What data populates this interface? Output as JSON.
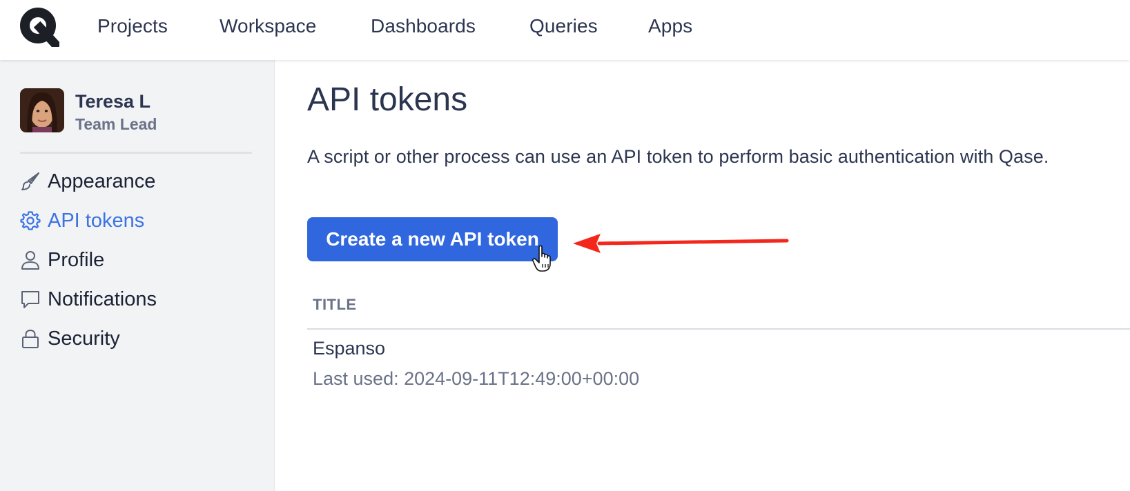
{
  "nav": {
    "logo_icon": "qase-q-logo",
    "items": [
      {
        "label": "Projects"
      },
      {
        "label": "Workspace"
      },
      {
        "label": "Dashboards"
      },
      {
        "label": "Queries"
      },
      {
        "label": "Apps"
      }
    ]
  },
  "sidebar": {
    "user": {
      "name": "Teresa L",
      "role": "Team Lead"
    },
    "items": [
      {
        "label": "Appearance",
        "icon": "brush-icon"
      },
      {
        "label": "API tokens",
        "icon": "gear-icon",
        "active": true
      },
      {
        "label": "Profile",
        "icon": "user-icon"
      },
      {
        "label": "Notifications",
        "icon": "chat-bubble-icon"
      },
      {
        "label": "Security",
        "icon": "lock-icon"
      }
    ]
  },
  "main": {
    "title": "API tokens",
    "description": "A script or other process can use an API token to perform basic authentication with Qase.",
    "create_button_label": "Create a new API token",
    "table": {
      "column_header": "TITLE",
      "rows": [
        {
          "title": "Espanso",
          "last_used": "Last used: 2024-09-11T12:49:00+00:00"
        }
      ]
    }
  },
  "colors": {
    "accent": "#3067de",
    "active_link": "#3b73e3",
    "annotation_arrow": "#f4271c",
    "sidebar_bg": "#f2f3f5",
    "text": "#2c3550",
    "muted_text": "#6a7287"
  }
}
